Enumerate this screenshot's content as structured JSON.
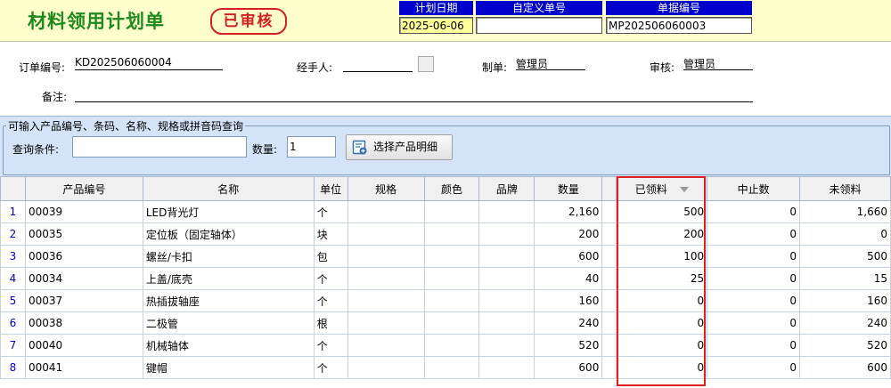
{
  "header": {
    "title": "材料领用计划单",
    "status_stamp": "已审核",
    "plan_date_label": "计划日期",
    "plan_date_value": "2025-06-06",
    "custom_no_label": "自定义单号",
    "custom_no_value": "",
    "doc_no_label": "单据编号",
    "doc_no_value": "MP202506060003"
  },
  "form": {
    "order_no_label": "订单编号:",
    "order_no_value": "KD202506060004",
    "handler_label": "经手人:",
    "handler_value": "",
    "maker_label": "制单:",
    "maker_value": "管理员",
    "reviewer_label": "审核:",
    "reviewer_value": "管理员",
    "remark_label": "备注:",
    "remark_value": ""
  },
  "query": {
    "group_title": "可输入产品编号、条码、名称、规格或拼音码查询",
    "condition_label": "查询条件:",
    "condition_value": "",
    "qty_label": "数量:",
    "qty_value": "1",
    "select_button_label": "选择产品明细"
  },
  "grid": {
    "columns": [
      "产品编号",
      "名称",
      "单位",
      "规格",
      "颜色",
      "品牌",
      "数量",
      "已领料",
      "中止数",
      "未领料"
    ],
    "rows": [
      {
        "rn": "1",
        "code": "00039",
        "name": "LED背光灯",
        "unit": "个",
        "spec": "",
        "color": "",
        "brand": "",
        "qty": "2,160",
        "received": "500",
        "stopped": "0",
        "unreceived": "1,660"
      },
      {
        "rn": "2",
        "code": "00035",
        "name": "定位板（固定轴体）",
        "unit": "块",
        "spec": "",
        "color": "",
        "brand": "",
        "qty": "200",
        "received": "200",
        "stopped": "0",
        "unreceived": "0"
      },
      {
        "rn": "3",
        "code": "00036",
        "name": "螺丝/卡扣",
        "unit": "包",
        "spec": "",
        "color": "",
        "brand": "",
        "qty": "600",
        "received": "100",
        "stopped": "0",
        "unreceived": "500"
      },
      {
        "rn": "4",
        "code": "00034",
        "name": "上盖/底壳",
        "unit": "个",
        "spec": "",
        "color": "",
        "brand": "",
        "qty": "40",
        "received": "25",
        "stopped": "0",
        "unreceived": "15"
      },
      {
        "rn": "5",
        "code": "00037",
        "name": "热插拔轴座",
        "unit": "个",
        "spec": "",
        "color": "",
        "brand": "",
        "qty": "160",
        "received": "0",
        "stopped": "0",
        "unreceived": "160"
      },
      {
        "rn": "6",
        "code": "00038",
        "name": "二极管",
        "unit": "根",
        "spec": "",
        "color": "",
        "brand": "",
        "qty": "240",
        "received": "0",
        "stopped": "0",
        "unreceived": "240"
      },
      {
        "rn": "7",
        "code": "00040",
        "name": "机械轴体",
        "unit": "个",
        "spec": "",
        "color": "",
        "brand": "",
        "qty": "520",
        "received": "0",
        "stopped": "0",
        "unreceived": "520"
      },
      {
        "rn": "8",
        "code": "00041",
        "name": "键帽",
        "unit": "个",
        "spec": "",
        "color": "",
        "brand": "",
        "qty": "600",
        "received": "0",
        "stopped": "0",
        "unreceived": "600"
      }
    ]
  },
  "colors": {
    "title_green": "#1e8a1e",
    "stamp_red": "#d42020",
    "header_blue": "#0000cc",
    "banner_yellow": "#ffffcc",
    "query_blue": "#d4e3f7",
    "highlight_red": "#e02020"
  }
}
